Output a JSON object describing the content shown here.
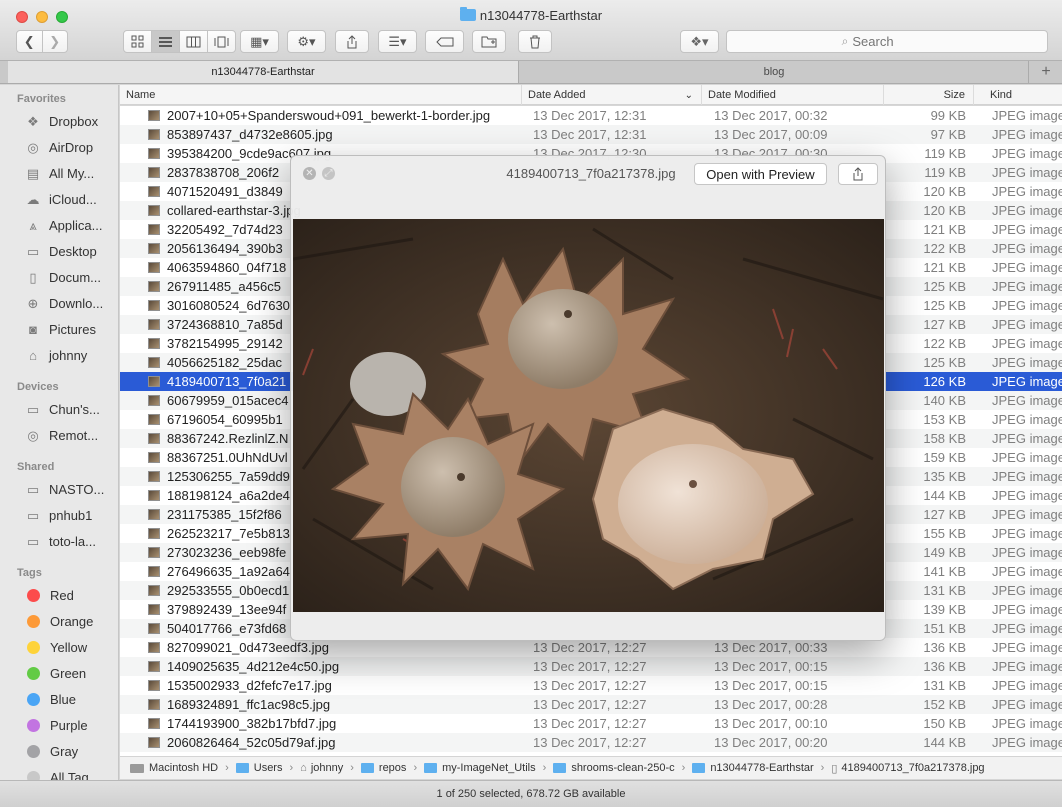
{
  "window": {
    "title": "n13044778-Earthstar"
  },
  "toolbar": {
    "search_placeholder": "Search"
  },
  "tabs": [
    {
      "label": "n13044778-Earthstar"
    },
    {
      "label": "blog"
    }
  ],
  "tab_add": "+",
  "sidebar": {
    "favorites_heading": "Favorites",
    "favorites": [
      "Dropbox",
      "AirDrop",
      "All My...",
      "iCloud...",
      "Applica...",
      "Desktop",
      "Docum...",
      "Downlo...",
      "Pictures",
      "johnny"
    ],
    "devices_heading": "Devices",
    "devices": [
      "Chun's...",
      "Remot..."
    ],
    "shared_heading": "Shared",
    "shared": [
      "NASTO...",
      "pnhub1",
      "toto-la..."
    ],
    "tags_heading": "Tags",
    "tags": [
      {
        "label": "Red",
        "color": "#fc4c4c"
      },
      {
        "label": "Orange",
        "color": "#fd9a38"
      },
      {
        "label": "Yellow",
        "color": "#fed33a"
      },
      {
        "label": "Green",
        "color": "#62cb45"
      },
      {
        "label": "Blue",
        "color": "#4aa5f5"
      },
      {
        "label": "Purple",
        "color": "#c274e1"
      },
      {
        "label": "Gray",
        "color": "#a3a3a6"
      },
      {
        "label": "All Tag...",
        "color": "#c8c8c8"
      }
    ]
  },
  "columns": {
    "name": "Name",
    "date_added": "Date Added",
    "date_modified": "Date Modified",
    "size": "Size",
    "kind": "Kind"
  },
  "files": [
    {
      "name": "2007+10+05+Spanderswoud+091_bewerkt-1-border.jpg",
      "added": "13 Dec 2017, 12:31",
      "modified": "13 Dec 2017, 00:32",
      "size": "99 KB",
      "kind": "JPEG image"
    },
    {
      "name": "853897437_d4732e8605.jpg",
      "added": "13 Dec 2017, 12:31",
      "modified": "13 Dec 2017, 00:09",
      "size": "97 KB",
      "kind": "JPEG image"
    },
    {
      "name": "395384200_9cde9ac607.jpg",
      "added": "13 Dec 2017, 12:30",
      "modified": "13 Dec 2017, 00:30",
      "size": "119 KB",
      "kind": "JPEG image"
    },
    {
      "name": "2837838708_206f2",
      "added": "",
      "modified": "",
      "size": "119 KB",
      "kind": "JPEG image"
    },
    {
      "name": "4071520491_d3849",
      "added": "",
      "modified": "",
      "size": "120 KB",
      "kind": "JPEG image"
    },
    {
      "name": "collared-earthstar-3.jpg",
      "added": "",
      "modified": "",
      "size": "120 KB",
      "kind": "JPEG image"
    },
    {
      "name": "32205492_7d74d23",
      "added": "",
      "modified": "",
      "size": "121 KB",
      "kind": "JPEG image"
    },
    {
      "name": "2056136494_390b3",
      "added": "",
      "modified": "",
      "size": "122 KB",
      "kind": "JPEG image"
    },
    {
      "name": "4063594860_04f718",
      "added": "",
      "modified": "",
      "size": "121 KB",
      "kind": "JPEG image"
    },
    {
      "name": "267911485_a456c5",
      "added": "",
      "modified": "",
      "size": "125 KB",
      "kind": "JPEG image"
    },
    {
      "name": "3016080524_6d7630",
      "added": "",
      "modified": "",
      "size": "125 KB",
      "kind": "JPEG image"
    },
    {
      "name": "3724368810_7a85d",
      "added": "",
      "modified": "",
      "size": "127 KB",
      "kind": "JPEG image"
    },
    {
      "name": "3782154995_29142",
      "added": "",
      "modified": "",
      "size": "122 KB",
      "kind": "JPEG image"
    },
    {
      "name": "4056625182_25dac",
      "added": "",
      "modified": "",
      "size": "125 KB",
      "kind": "JPEG image"
    },
    {
      "name": "4189400713_7f0a21",
      "added": "",
      "modified": "",
      "size": "126 KB",
      "kind": "JPEG image",
      "selected": true
    },
    {
      "name": "60679959_015acec4",
      "added": "",
      "modified": "",
      "size": "140 KB",
      "kind": "JPEG image"
    },
    {
      "name": "67196054_60995b1",
      "added": "",
      "modified": "",
      "size": "153 KB",
      "kind": "JPEG image"
    },
    {
      "name": "88367242.RezlinlZ.N",
      "added": "",
      "modified": "",
      "size": "158 KB",
      "kind": "JPEG image"
    },
    {
      "name": "88367251.0UhNdUvl",
      "added": "",
      "modified": "",
      "size": "159 KB",
      "kind": "JPEG image"
    },
    {
      "name": "125306255_7a59dd9",
      "added": "",
      "modified": "",
      "size": "135 KB",
      "kind": "JPEG image"
    },
    {
      "name": "188198124_a6a2de4",
      "added": "",
      "modified": "",
      "size": "144 KB",
      "kind": "JPEG image"
    },
    {
      "name": "231175385_15f2f86",
      "added": "",
      "modified": "",
      "size": "127 KB",
      "kind": "JPEG image"
    },
    {
      "name": "262523217_7e5b813",
      "added": "",
      "modified": "",
      "size": "155 KB",
      "kind": "JPEG image"
    },
    {
      "name": "273023236_eeb98fe",
      "added": "",
      "modified": "",
      "size": "149 KB",
      "kind": "JPEG image"
    },
    {
      "name": "276496635_1a92a64",
      "added": "",
      "modified": "",
      "size": "141 KB",
      "kind": "JPEG image"
    },
    {
      "name": "292533555_0b0ecd1",
      "added": "",
      "modified": "",
      "size": "131 KB",
      "kind": "JPEG image"
    },
    {
      "name": "379892439_13ee94f",
      "added": "",
      "modified": "",
      "size": "139 KB",
      "kind": "JPEG image"
    },
    {
      "name": "504017766_e73fd68",
      "added": "",
      "modified": "",
      "size": "151 KB",
      "kind": "JPEG image"
    },
    {
      "name": "827099021_0d473eedf3.jpg",
      "added": "13 Dec 2017, 12:27",
      "modified": "13 Dec 2017, 00:33",
      "size": "136 KB",
      "kind": "JPEG image"
    },
    {
      "name": "1409025635_4d212e4c50.jpg",
      "added": "13 Dec 2017, 12:27",
      "modified": "13 Dec 2017, 00:15",
      "size": "136 KB",
      "kind": "JPEG image"
    },
    {
      "name": "1535002933_d2fefc7e17.jpg",
      "added": "13 Dec 2017, 12:27",
      "modified": "13 Dec 2017, 00:15",
      "size": "131 KB",
      "kind": "JPEG image"
    },
    {
      "name": "1689324891_ffc1ac98c5.jpg",
      "added": "13 Dec 2017, 12:27",
      "modified": "13 Dec 2017, 00:28",
      "size": "152 KB",
      "kind": "JPEG image"
    },
    {
      "name": "1744193900_382b17bfd7.jpg",
      "added": "13 Dec 2017, 12:27",
      "modified": "13 Dec 2017, 00:10",
      "size": "150 KB",
      "kind": "JPEG image"
    },
    {
      "name": "2060826464_52c05d79af.jpg",
      "added": "13 Dec 2017, 12:27",
      "modified": "13 Dec 2017, 00:20",
      "size": "144 KB",
      "kind": "JPEG image"
    }
  ],
  "pathbar": [
    "Macintosh HD",
    "Users",
    "johnny",
    "repos",
    "my-ImageNet_Utils",
    "shrooms-clean-250-c",
    "n13044778-Earthstar",
    "4189400713_7f0a217378.jpg"
  ],
  "status": "1 of 250 selected, 678.72 GB available",
  "quicklook": {
    "title": "4189400713_7f0a217378.jpg",
    "open_button": "Open with Preview"
  }
}
